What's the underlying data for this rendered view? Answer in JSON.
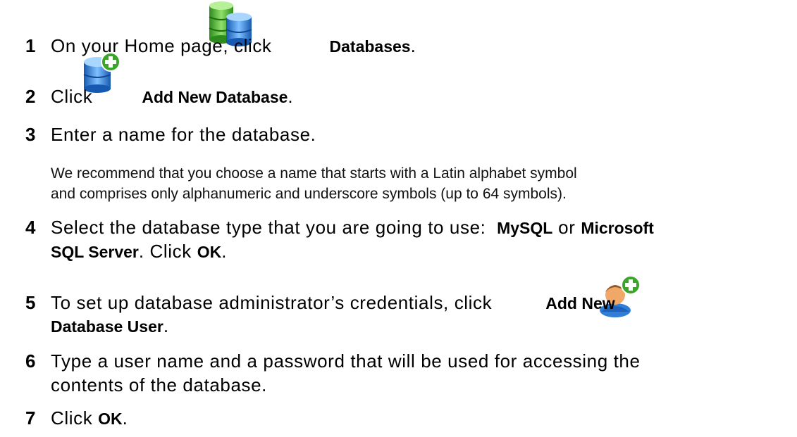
{
  "steps": [
    {
      "num": "1",
      "text_before": "On your Home page, click",
      "bold": "Databases",
      "text_after": "."
    },
    {
      "num": "2",
      "text_before": "Click",
      "bold": "Add New Database",
      "text_after": "."
    },
    {
      "num": "3",
      "text": "Enter a name for the database.",
      "note_line1": "We recommend that you choose a name that starts with a Latin alphabet symbol",
      "note_line2": "and comprises only alphanumeric and underscore symbols (up to 64 symbols)."
    },
    {
      "num": "4",
      "text_before": "Select the database type that you are going to use:",
      "bold1": "MySQL",
      "mid": "or",
      "bold2": "Microsoft",
      "bold2_cont": "SQL Server",
      "text_after": ". Click",
      "bold3": "OK",
      "end": "."
    },
    {
      "num": "5",
      "text_before": "To set up database administrator’s credentials, click",
      "bold": "Add New",
      "bold_cont": "Database User",
      "end": "."
    },
    {
      "num": "6",
      "line1": "Type a user name and a password that will be used for accessing the",
      "line2": "contents of the database."
    },
    {
      "num": "7",
      "text_before": "Click",
      "bold": "OK",
      "end": "."
    }
  ],
  "icons": {
    "databases": "databases-icon",
    "add_database": "add-database-icon",
    "add_user": "add-database-user-icon"
  },
  "colors": {
    "db_green": "#4caf2f",
    "db_blue": "#2f7fd8",
    "plus_green": "#3aa52a",
    "user_orange": "#f0a868"
  }
}
